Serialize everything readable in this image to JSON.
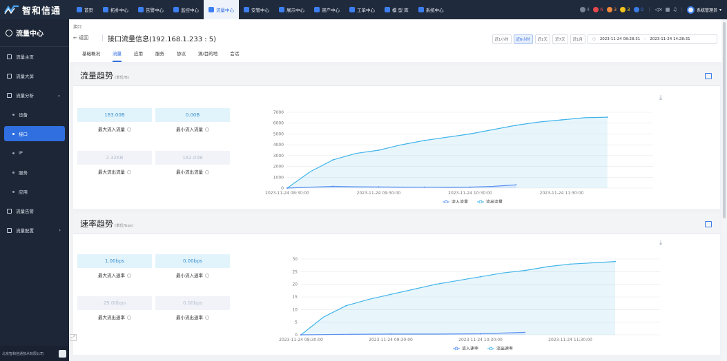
{
  "top": {
    "logo_text": "智和信通",
    "nav": [
      "首页",
      "拓扑中心",
      "告警中心",
      "监控中心",
      "流量中心",
      "安管中心",
      "展示中心",
      "资产中心",
      "工单中心",
      "模 型 库",
      "系统中心"
    ],
    "active_nav": 4,
    "alert_badges": [
      {
        "count": "4",
        "color": "#7a8393"
      },
      {
        "count": "6",
        "color": "#e5484d"
      },
      {
        "count": "3",
        "color": "#f08a3c"
      },
      {
        "count": "3",
        "color": "#f2c31b"
      },
      {
        "count": "0",
        "color": "#3b7ce6"
      }
    ],
    "user_name": "系统管理员"
  },
  "sidebar": {
    "title": "流量中心",
    "items": [
      {
        "label": "流量主页",
        "type": "item"
      },
      {
        "label": "流量大屏",
        "type": "item"
      },
      {
        "label": "流量分析",
        "type": "item",
        "expanded": true
      },
      {
        "label": "设备",
        "type": "sub"
      },
      {
        "label": "接口",
        "type": "sub",
        "active": true
      },
      {
        "label": "IP",
        "type": "sub"
      },
      {
        "label": "服务",
        "type": "sub"
      },
      {
        "label": "应用",
        "type": "sub"
      },
      {
        "label": "流量告警",
        "type": "item"
      },
      {
        "label": "流量配置",
        "type": "item"
      }
    ],
    "footer": "北京智和信通技术有限公司"
  },
  "header": {
    "breadcrumb": "接口",
    "back": "← 返回",
    "title": "接口流量信息(192.168.1.233 : 5)",
    "time_buttons": [
      "近1小时",
      "近6小时",
      "近1天",
      "近7天",
      "近1月"
    ],
    "active_time": 1,
    "range_start": "2023-11-24 08:28:31",
    "range_sep": "-",
    "range_end": "2023-11-24 14:28:31",
    "tabs": [
      "基础概况",
      "流量",
      "应用",
      "服务",
      "协议",
      "源/目的地",
      "会话"
    ],
    "active_tab": 1
  },
  "traffic": {
    "title": "流量趋势",
    "unit": "(单位/B)",
    "max_in": "183.00B",
    "max_in_label": "最大流入流量",
    "min_in": "0.00B",
    "min_in_label": "最小流入流量",
    "max_out": "2.32KB",
    "max_out_label": "最大流出流量",
    "min_out": "162.00B",
    "min_out_label": "最小流出流量"
  },
  "rate": {
    "title": "速率趋势",
    "unit": "(单位/bps)",
    "max_in": "1.00bps",
    "max_in_label": "最大流入速率",
    "min_in": "0.00bps",
    "min_in_label": "最小流入速率",
    "max_out": "29.00bps",
    "max_out_label": "最大流出速率",
    "min_out": "0.00bps",
    "min_out_label": "最小流出速率"
  },
  "chart_data": [
    {
      "type": "area",
      "x_ticks": [
        "2023-11-24 08:30:00",
        "2023-11-24 09:30:00",
        "2023-11-24 10:30:00",
        "2023-11-24 11:30:00"
      ],
      "ylim": [
        0,
        7000
      ],
      "y_ticks": [
        0,
        1000,
        2000,
        3000,
        4000,
        5000,
        6000,
        7000
      ],
      "legend": [
        "流入流量",
        "流出流量"
      ],
      "series": [
        {
          "name": "流入流量",
          "color": "#5b8ff0",
          "x": [
            0,
            0.25,
            0.5,
            0.75,
            1,
            1.25,
            1.5,
            1.75,
            2,
            2.25,
            2.5
          ],
          "values": [
            0,
            80,
            160,
            120,
            100,
            90,
            80,
            70,
            90,
            160,
            300
          ]
        },
        {
          "name": "流出流量",
          "color": "#41b4ea",
          "x": [
            0,
            0.25,
            0.5,
            0.75,
            1,
            1.25,
            1.5,
            1.75,
            2,
            2.25,
            2.5,
            2.75,
            3,
            3.25,
            3.5
          ],
          "values": [
            0,
            1500,
            2600,
            3200,
            3500,
            4000,
            4400,
            4700,
            5000,
            5400,
            5800,
            6100,
            6300,
            6500,
            6550
          ]
        }
      ]
    },
    {
      "type": "area",
      "x_ticks": [
        "2023-11-24 08:30:00",
        "2023-11-24 09:30:00",
        "2023-11-24 10:30:00",
        "2023-11-24 11:30:00"
      ],
      "ylim": [
        0,
        30
      ],
      "y_ticks": [
        0,
        5,
        10,
        15,
        20,
        25,
        30
      ],
      "legend": [
        "流入速率",
        "流出速率"
      ],
      "series": [
        {
          "name": "流入速率",
          "color": "#5b8ff0",
          "x": [
            0,
            0.5,
            1,
            1.5,
            2,
            2.5
          ],
          "values": [
            0,
            0.2,
            0.3,
            0.3,
            0.4,
            1
          ]
        },
        {
          "name": "流出速率",
          "color": "#41b4ea",
          "x": [
            0,
            0.25,
            0.5,
            0.75,
            1,
            1.25,
            1.5,
            1.75,
            2,
            2.25,
            2.5,
            2.75,
            3,
            3.25,
            3.5
          ],
          "values": [
            0,
            7,
            11.5,
            14,
            16,
            18,
            20,
            21.5,
            23,
            24.5,
            25.5,
            27,
            28,
            28.5,
            29
          ]
        }
      ]
    }
  ]
}
